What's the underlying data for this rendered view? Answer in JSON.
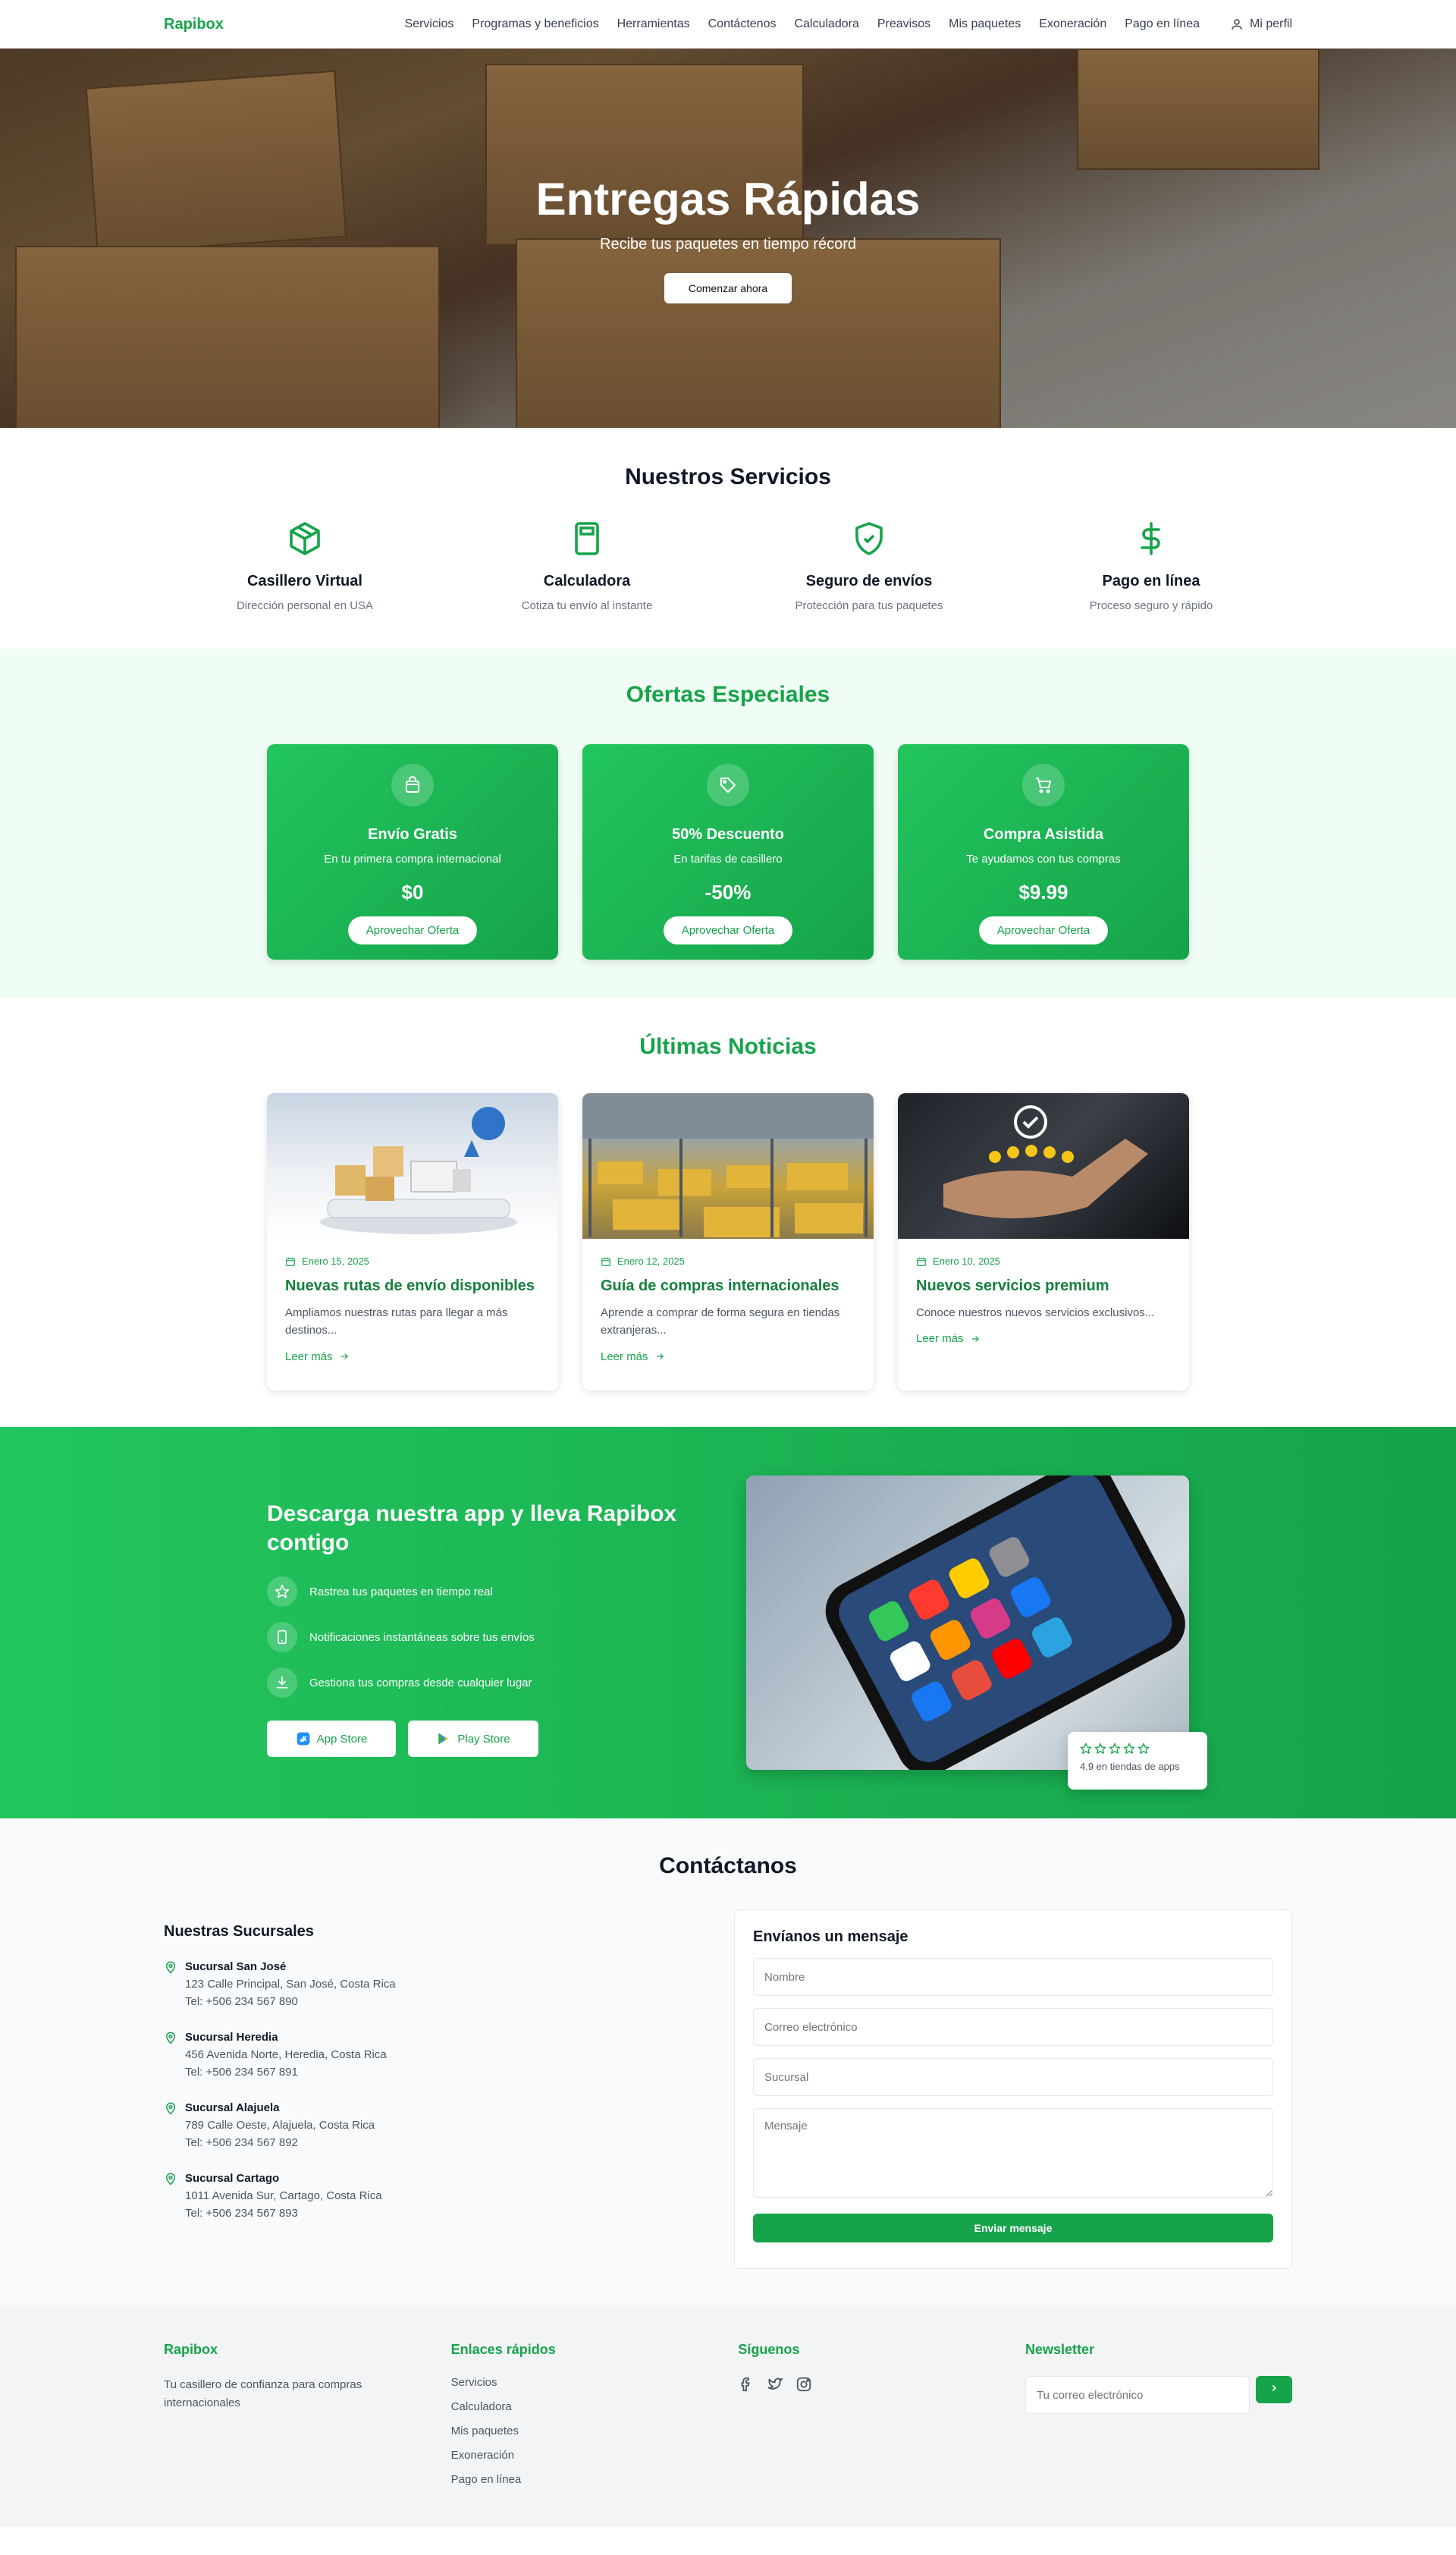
{
  "nav": {
    "brand": "Rapibox",
    "links": [
      "Servicios",
      "Programas y beneficios",
      "Herramientas",
      "Contáctenos",
      "Calculadora",
      "Preavisos",
      "Mis paquetes",
      "Exoneración",
      "Pago en línea"
    ],
    "profile": "Mi perfil"
  },
  "hero": {
    "title": "Entregas Rápidas",
    "subtitle": "Recibe tus paquetes en tiempo récord",
    "button": "Comenzar ahora"
  },
  "services": {
    "title": "Nuestros Servicios",
    "items": [
      {
        "title": "Casillero Virtual",
        "desc": "Dirección personal en USA",
        "icon": "box-icon"
      },
      {
        "title": "Calculadora",
        "desc": "Cotiza tu envío al instante",
        "icon": "calculator-icon"
      },
      {
        "title": "Seguro de envíos",
        "desc": "Protección para tus paquetes",
        "icon": "shield-icon"
      },
      {
        "title": "Pago en línea",
        "desc": "Proceso seguro y rápido",
        "icon": "dollar-icon"
      }
    ]
  },
  "offers": {
    "title": "Ofertas Especiales",
    "items": [
      {
        "title": "Envío Gratis",
        "desc": "En tu primera compra internacional",
        "price": "$0",
        "button": "Aprovechar Oferta",
        "icon": "shopping-bag-icon"
      },
      {
        "title": "50% Descuento",
        "desc": "En tarifas de casillero",
        "price": "-50%",
        "button": "Aprovechar Oferta",
        "icon": "tag-icon"
      },
      {
        "title": "Compra Asistida",
        "desc": "Te ayudamos con tus compras",
        "price": "$9.99",
        "button": "Aprovechar Oferta",
        "icon": "cart-icon"
      }
    ]
  },
  "news": {
    "title": "Últimas Noticias",
    "items": [
      {
        "date": "Enero 15, 2025",
        "title": "Nuevas rutas de envío disponibles",
        "desc": "Ampliamos nuestras rutas para llegar a más destinos...",
        "link": "Leer más"
      },
      {
        "date": "Enero 12, 2025",
        "title": "Guía de compras internacionales",
        "desc": "Aprende a comprar de forma segura en tiendas extranjeras...",
        "link": "Leer más"
      },
      {
        "date": "Enero 10, 2025",
        "title": "Nuevos servicios premium",
        "desc": "Conoce nuestros nuevos servicios exclusivos...",
        "link": "Leer más"
      }
    ]
  },
  "app": {
    "title": "Descarga nuestra app y lleva Rapibox contigo",
    "features": [
      {
        "text": "Rastrea tus paquetes en tiempo real",
        "icon": "star-icon"
      },
      {
        "text": "Notificaciones instantáneas sobre tus envíos",
        "icon": "phone-icon"
      },
      {
        "text": "Gestiona tus compras desde cualquier lugar",
        "icon": "download-icon"
      }
    ],
    "app_store": "App Store",
    "play_store": "Play Store",
    "rating": "4.9 en tiendas de apps",
    "rating_stars": 5
  },
  "contact": {
    "title": "Contáctanos",
    "branches_title": "Nuestras Sucursales",
    "branches": [
      {
        "name": "Sucursal San José",
        "address": "123 Calle Principal, San José, Costa Rica",
        "phone": "Tel: +506 234 567 890"
      },
      {
        "name": "Sucursal Heredia",
        "address": "456 Avenida Norte, Heredia, Costa Rica",
        "phone": "Tel: +506 234 567 891"
      },
      {
        "name": "Sucursal Alajuela",
        "address": "789 Calle Oeste, Alajuela, Costa Rica",
        "phone": "Tel: +506 234 567 892"
      },
      {
        "name": "Sucursal Cartago",
        "address": "1011 Avenida Sur, Cartago, Costa Rica",
        "phone": "Tel: +506 234 567 893"
      }
    ],
    "form": {
      "title": "Envíanos un mensaje",
      "name_placeholder": "Nombre",
      "email_placeholder": "Correo electrónico",
      "branch_placeholder": "Sucursal",
      "message_placeholder": "Mensaje",
      "submit": "Enviar mensaje"
    }
  },
  "footer": {
    "brand": "Rapibox",
    "tagline": "Tu casillero de confianza para compras internacionales",
    "links_title": "Enlaces rápidos",
    "links": [
      "Servicios",
      "Calculadora",
      "Mis paquetes",
      "Exoneración",
      "Pago en línea"
    ],
    "social_title": "Síguenos",
    "newsletter_title": "Newsletter",
    "newsletter_placeholder": "Tu correo electrónico"
  },
  "colors": {
    "brand_green": "#16a34a",
    "light_green_bg": "#f0fdf4"
  }
}
